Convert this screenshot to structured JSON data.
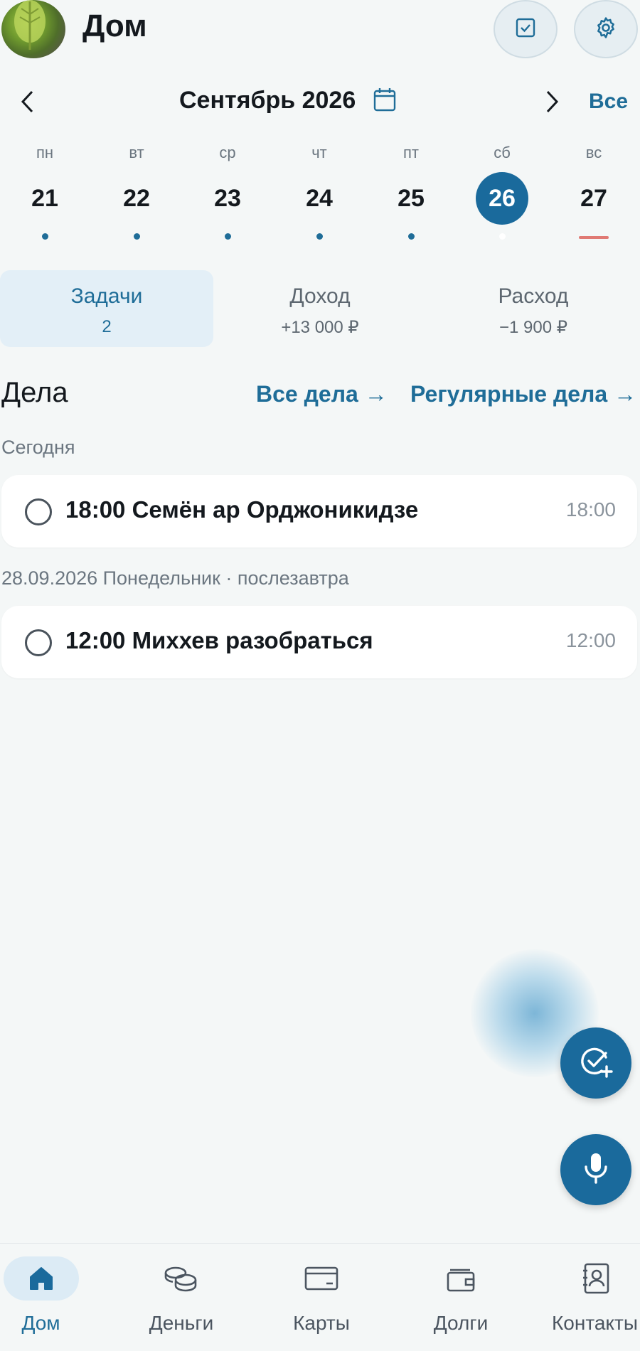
{
  "header": {
    "title": "Дом"
  },
  "month_nav": {
    "label": "Сентябрь 2026",
    "all_label": "Все"
  },
  "week": {
    "days": [
      {
        "name": "пн",
        "num": "21"
      },
      {
        "name": "вт",
        "num": "22"
      },
      {
        "name": "ср",
        "num": "23"
      },
      {
        "name": "чт",
        "num": "24"
      },
      {
        "name": "пт",
        "num": "25"
      },
      {
        "name": "сб",
        "num": "26"
      },
      {
        "name": "вс",
        "num": "27"
      }
    ],
    "selected_num": "26"
  },
  "summary": {
    "tabs": [
      {
        "title": "Задачи",
        "value": "2"
      },
      {
        "title": "Доход",
        "value": "+13 000 ₽"
      },
      {
        "title": "Расход",
        "value": "−1 900 ₽"
      }
    ]
  },
  "tasks_section": {
    "title": "Дела",
    "all_link": "Все дела →",
    "regular_link": "Регулярные дела →",
    "groups": [
      {
        "label": "Сегодня",
        "items": [
          {
            "title": "18:00 Семён ар Орджоникидзе",
            "time": "18:00"
          }
        ]
      },
      {
        "label": "28.09.2026 Понедельник · послезавтра",
        "items": [
          {
            "title": "12:00 Миххев разобраться",
            "time": "12:00"
          }
        ]
      }
    ]
  },
  "bottom_nav": {
    "items": [
      {
        "label": "Дом",
        "icon": "home-icon"
      },
      {
        "label": "Деньги",
        "icon": "coins-icon"
      },
      {
        "label": "Карты",
        "icon": "card-icon"
      },
      {
        "label": "Долги",
        "icon": "wallet-icon"
      },
      {
        "label": "Контакты",
        "icon": "contacts-icon"
      }
    ]
  },
  "colors": {
    "accent": "#1a6a9c",
    "link": "#1f6d98",
    "background": "#f4f7f7",
    "today_marker": "#e07a74"
  }
}
